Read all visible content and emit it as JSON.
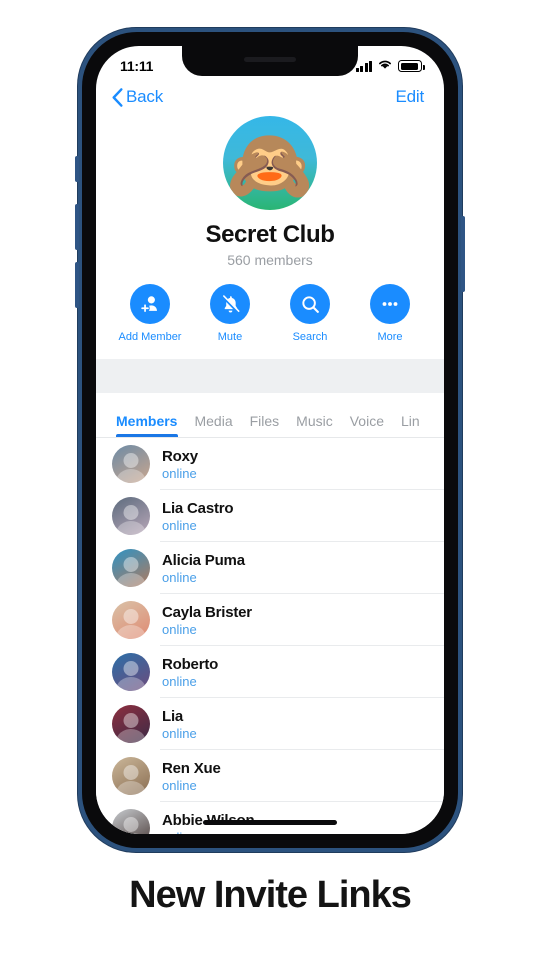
{
  "status_bar": {
    "time": "11:11",
    "signal_icon": "cellular-bars-icon",
    "wifi_icon": "wifi-icon",
    "battery_icon": "battery-full-icon"
  },
  "nav": {
    "back_label": "Back",
    "back_icon": "chevron-left-icon",
    "edit_label": "Edit"
  },
  "profile": {
    "avatar_emoji": "🙈",
    "avatar_icon": "see-no-evil-monkey-avatar",
    "title": "Secret Club",
    "subtitle": "560 members"
  },
  "actions": [
    {
      "label": "Add Member",
      "icon": "add-member-icon"
    },
    {
      "label": "Mute",
      "icon": "bell-slash-icon"
    },
    {
      "label": "Search",
      "icon": "search-icon"
    },
    {
      "label": "More",
      "icon": "ellipsis-icon"
    }
  ],
  "tabs": [
    {
      "label": "Members",
      "active": true
    },
    {
      "label": "Media",
      "active": false
    },
    {
      "label": "Files",
      "active": false
    },
    {
      "label": "Music",
      "active": false
    },
    {
      "label": "Voice",
      "active": false
    },
    {
      "label": "Lin",
      "active": false
    }
  ],
  "members": [
    {
      "name": "Roxy",
      "status": "online",
      "avatar_color_a": "#6d8ba6",
      "avatar_color_b": "#c9a68e"
    },
    {
      "name": "Lia Castro",
      "status": "online",
      "avatar_color_a": "#5c6b7d",
      "avatar_color_b": "#b9a7b8"
    },
    {
      "name": "Alicia Puma",
      "status": "online",
      "avatar_color_a": "#2f93c4",
      "avatar_color_b": "#b07a5e"
    },
    {
      "name": "Cayla Brister",
      "status": "online",
      "avatar_color_a": "#d9c2a8",
      "avatar_color_b": "#e08a72"
    },
    {
      "name": "Roberto",
      "status": "online",
      "avatar_color_a": "#2b6fa8",
      "avatar_color_b": "#6d4b7c"
    },
    {
      "name": "Lia",
      "status": "online",
      "avatar_color_a": "#8e2f3f",
      "avatar_color_b": "#3b2a46"
    },
    {
      "name": "Ren Xue",
      "status": "online",
      "avatar_color_a": "#cbb79a",
      "avatar_color_b": "#8a6e52"
    },
    {
      "name": "Abbie Wilson",
      "status": "online",
      "avatar_color_a": "#c8ccd0",
      "avatar_color_b": "#4a3b38"
    }
  ],
  "caption": "New Invite Links",
  "colors": {
    "accent": "#1a8cff",
    "tab_underline": "#1a77e6",
    "frame": "#2c527e",
    "bezel": "#0a0a0c",
    "band": "#eef0f2",
    "status_text": "#4a9fe8",
    "muted_text": "#9a9ea3"
  }
}
